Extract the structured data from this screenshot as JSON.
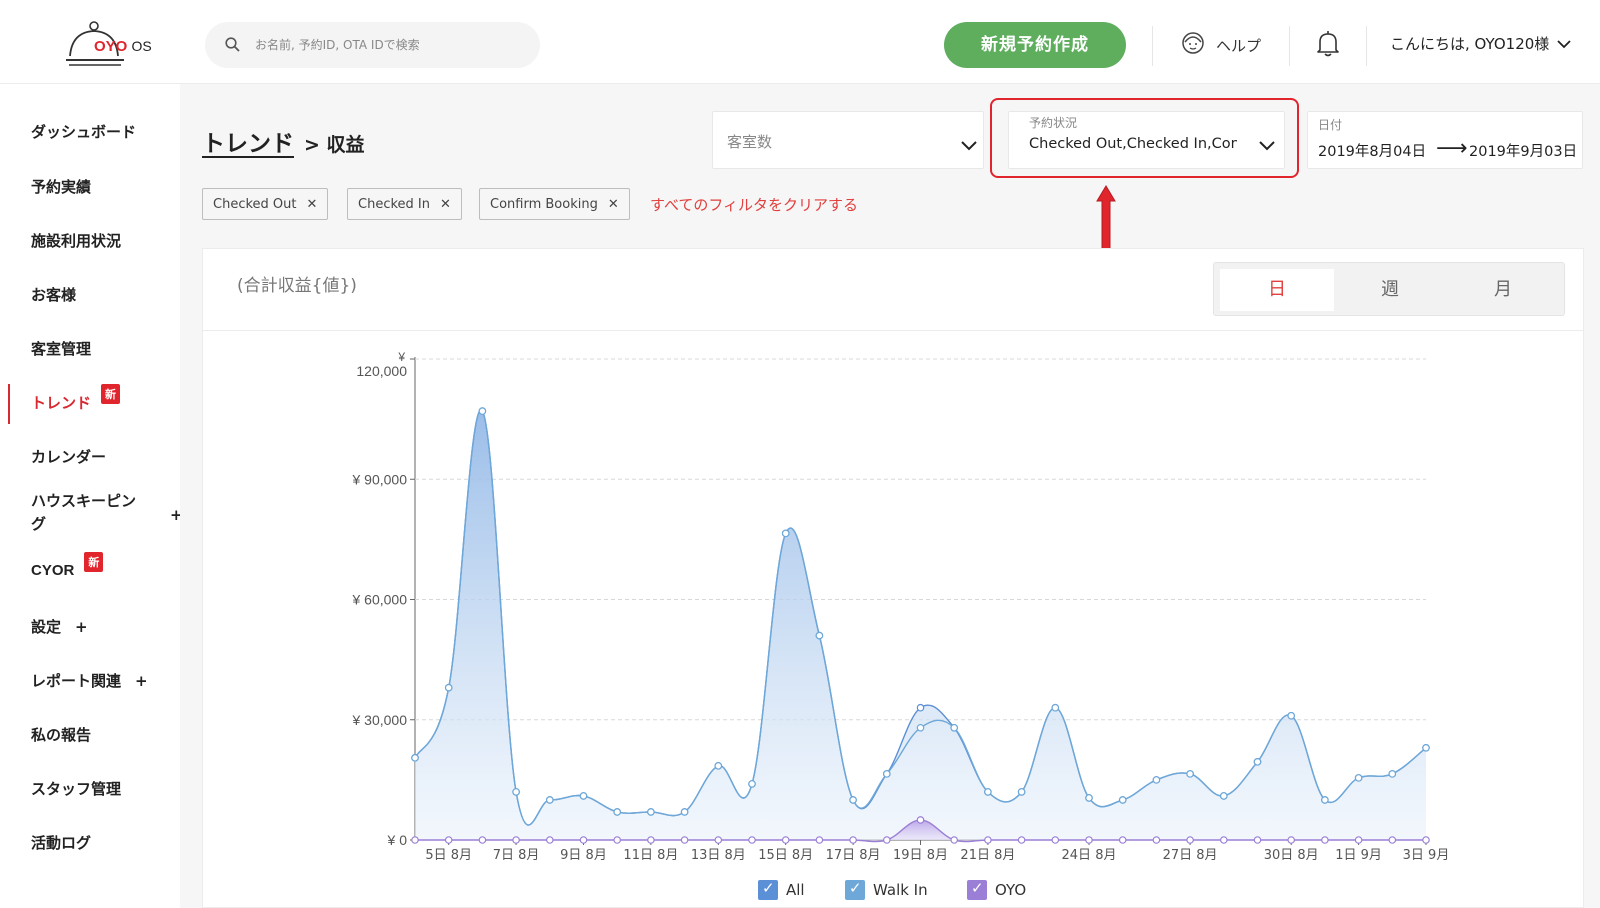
{
  "header": {
    "logo_text": "OYO",
    "logo_suffix": "OS",
    "search_placeholder": "お名前, 予約ID, OTA IDで検索",
    "new_booking_label": "新規予約作成",
    "help_label": "ヘルプ",
    "greeting": "こんにちは, OYO120様"
  },
  "sidebar": {
    "items": [
      {
        "label": "ダッシュボード"
      },
      {
        "label": "予約実績"
      },
      {
        "label": "施設利用状況"
      },
      {
        "label": "お客様"
      },
      {
        "label": "客室管理"
      },
      {
        "label": "トレンド",
        "badge": "新"
      },
      {
        "label": "カレンダー"
      },
      {
        "label": "ハウスキーピン",
        "label2": "グ",
        "plus": "+"
      },
      {
        "label": "CYOR",
        "badge": "新"
      },
      {
        "label": "設定",
        "plus": "+"
      },
      {
        "label": "レポート関連",
        "plus": "+"
      },
      {
        "label": "私の報告"
      },
      {
        "label": "スタッフ管理"
      },
      {
        "label": "活動ログ"
      }
    ]
  },
  "breadcrumb": {
    "link": "トレンド",
    "rest": "> 収益"
  },
  "filters": {
    "rooms": {
      "placeholder": "客室数"
    },
    "status": {
      "label": "予約状況",
      "value": "Checked Out,Checked In,Confirm Booking"
    },
    "date": {
      "label": "日付",
      "from": "2019年8月04日",
      "arrow": "⟶",
      "to": "2019年9月03日"
    }
  },
  "chips": [
    "Checked Out",
    "Checked In",
    "Confirm Booking"
  ],
  "clear_filters": "すべてのフィルタをクリアする",
  "card": {
    "title": "(合計収益{値})",
    "periods": [
      "日",
      "週",
      "月"
    ],
    "selected_period": "日"
  },
  "legend": [
    {
      "name": "All",
      "color": "#5b8fd6"
    },
    {
      "name": "Walk In",
      "color": "#6ea8d8"
    },
    {
      "name": "OYO",
      "color": "#9b7fd6"
    }
  ],
  "chart_data": {
    "type": "area",
    "currency_symbol": "¥",
    "y_ticks": [
      "¥ 0",
      "¥ 30,000",
      "¥ 60,000",
      "¥ 90,000",
      "120,000"
    ],
    "ylim": [
      0,
      120000
    ],
    "x_ticks": [
      "5日 8月",
      "7日 8月",
      "9日 8月",
      "11日 8月",
      "13日 8月",
      "15日 8月",
      "17日 8月",
      "19日 8月",
      "21日 8月",
      "24日 8月",
      "27日 8月",
      "30日 8月",
      "1日 9月",
      "3日 9月"
    ],
    "x": [
      "4日 8月",
      "5日 8月",
      "6日 8月",
      "7日 8月",
      "8日 8月",
      "9日 8月",
      "10日 8月",
      "11日 8月",
      "12日 8月",
      "13日 8月",
      "14日 8月",
      "15日 8月",
      "16日 8月",
      "17日 8月",
      "18日 8月",
      "19日 8月",
      "20日 8月",
      "21日 8月",
      "22日 8月",
      "23日 8月",
      "24日 8月",
      "25日 8月",
      "26日 8月",
      "27日 8月",
      "28日 8月",
      "29日 8月",
      "30日 8月",
      "31日 8月",
      "1日 9月",
      "2日 9月",
      "3日 9月"
    ],
    "series": [
      {
        "name": "All",
        "values": [
          20500,
          38000,
          107000,
          12000,
          10000,
          11000,
          7000,
          7000,
          7000,
          18500,
          14000,
          76500,
          51000,
          10000,
          16500,
          33000,
          28000,
          12000,
          12000,
          33000,
          10500,
          10000,
          15000,
          16500,
          11000,
          19500,
          31000,
          10000,
          15500,
          16500,
          23000
        ]
      },
      {
        "name": "Walk In",
        "values": [
          20500,
          38000,
          107000,
          12000,
          10000,
          11000,
          7000,
          7000,
          7000,
          18500,
          14000,
          76500,
          51000,
          10000,
          16500,
          28000,
          28000,
          12000,
          12000,
          33000,
          10500,
          10000,
          15000,
          16500,
          11000,
          19500,
          31000,
          10000,
          15500,
          16500,
          23000
        ]
      },
      {
        "name": "OYO",
        "values": [
          0,
          0,
          0,
          0,
          0,
          0,
          0,
          0,
          0,
          0,
          0,
          0,
          0,
          0,
          0,
          5000,
          0,
          0,
          0,
          0,
          0,
          0,
          0,
          0,
          0,
          0,
          0,
          0,
          0,
          0,
          0
        ]
      }
    ]
  }
}
